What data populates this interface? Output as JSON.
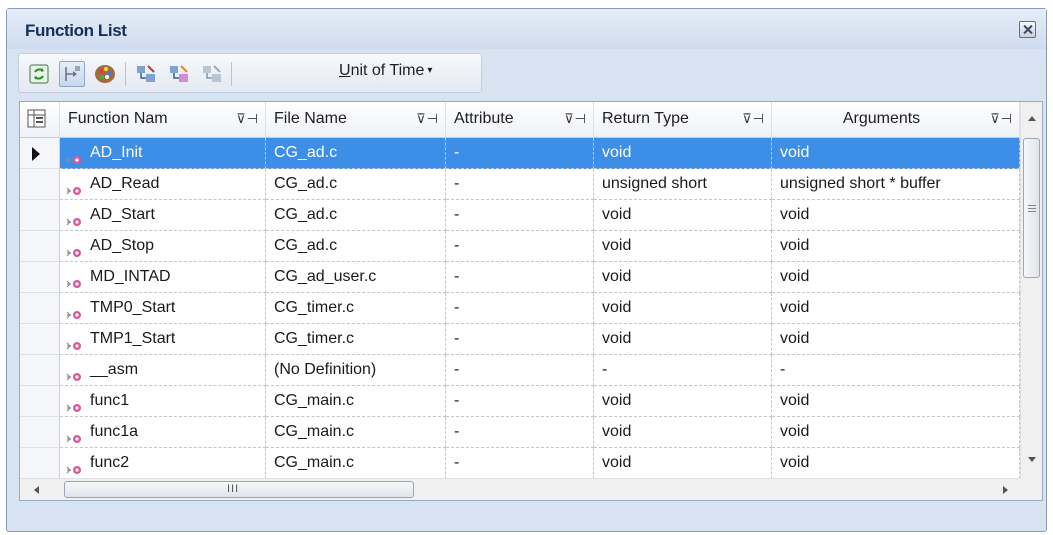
{
  "window": {
    "title": "Function List"
  },
  "toolbar": {
    "buttons": [
      {
        "name": "refresh-icon"
      },
      {
        "name": "jump-to-source-icon"
      },
      {
        "name": "color-palette-icon"
      },
      {
        "name": "coverage-icon"
      },
      {
        "name": "coverage-add-icon"
      },
      {
        "name": "coverage-clear-icon"
      }
    ],
    "unit_menu": {
      "mnemonic": "U",
      "rest": "nit of Time",
      "caret": "▾"
    }
  },
  "table": {
    "columns": [
      {
        "key": "name",
        "label": "Function Nam"
      },
      {
        "key": "file",
        "label": "File Name"
      },
      {
        "key": "attr",
        "label": "Attribute"
      },
      {
        "key": "ret",
        "label": "Return Type"
      },
      {
        "key": "args",
        "label": "Arguments"
      }
    ],
    "filter_pin_glyph": "⊽⊣",
    "rows": [
      {
        "name": "AD_Init",
        "file": "CG_ad.c",
        "attr": "-",
        "ret": "void",
        "args": "void",
        "selected": true
      },
      {
        "name": "AD_Read",
        "file": "CG_ad.c",
        "attr": "-",
        "ret": "unsigned short",
        "args": "unsigned short * buffer"
      },
      {
        "name": "AD_Start",
        "file": "CG_ad.c",
        "attr": "-",
        "ret": "void",
        "args": "void"
      },
      {
        "name": "AD_Stop",
        "file": "CG_ad.c",
        "attr": "-",
        "ret": "void",
        "args": "void"
      },
      {
        "name": "MD_INTAD",
        "file": "CG_ad_user.c",
        "attr": "-",
        "ret": "void",
        "args": "void"
      },
      {
        "name": "TMP0_Start",
        "file": "CG_timer.c",
        "attr": "-",
        "ret": "void",
        "args": "void"
      },
      {
        "name": "TMP1_Start",
        "file": "CG_timer.c",
        "attr": "-",
        "ret": "void",
        "args": "void"
      },
      {
        "name": "__asm",
        "file": "(No Definition)",
        "attr": "-",
        "ret": "-",
        "args": "-"
      },
      {
        "name": "func1",
        "file": "CG_main.c",
        "attr": "-",
        "ret": "void",
        "args": "void"
      },
      {
        "name": "func1a",
        "file": "CG_main.c",
        "attr": "-",
        "ret": "void",
        "args": "void"
      },
      {
        "name": "func2",
        "file": "CG_main.c",
        "attr": "-",
        "ret": "void",
        "args": "void"
      }
    ]
  },
  "scrollbar": {
    "h_grip": "III"
  },
  "colors": {
    "selection": "#3d8ee6",
    "title_text": "#15305c"
  }
}
